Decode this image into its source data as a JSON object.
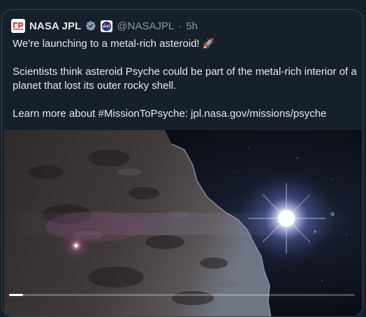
{
  "author": {
    "display_name": "NASA JPL",
    "handle": "@NASAJPL",
    "separator": "·",
    "timestamp": "5h",
    "avatar_icon": "jpl-logo-icon",
    "verified_icon": "verified-badge-icon",
    "affiliate_icon": "nasa-meatball-icon"
  },
  "tweet": {
    "line1": "We're launching to a metal-rich asteroid!",
    "line1_emoji": "🚀",
    "paragraph2": "Scientists think asteroid Psyche could be part of the metal-rich interior of a planet that lost its outer rocky shell.",
    "paragraph3_prefix": "Learn more about ",
    "hashtag": "#MissionToPsyche",
    "paragraph3_middle": ": ",
    "link": "jpl.nasa.gov/missions/psyche"
  },
  "media": {
    "type": "video",
    "description_icon": "asteroid-psyche-video",
    "progress": 0.04
  },
  "colors": {
    "background": "#15202b",
    "text": "#e7e9ea",
    "secondary_text": "#8b98a5",
    "border": "#38444d",
    "jpl_red": "#e03c31",
    "nasa_blue": "#0b3d91"
  }
}
